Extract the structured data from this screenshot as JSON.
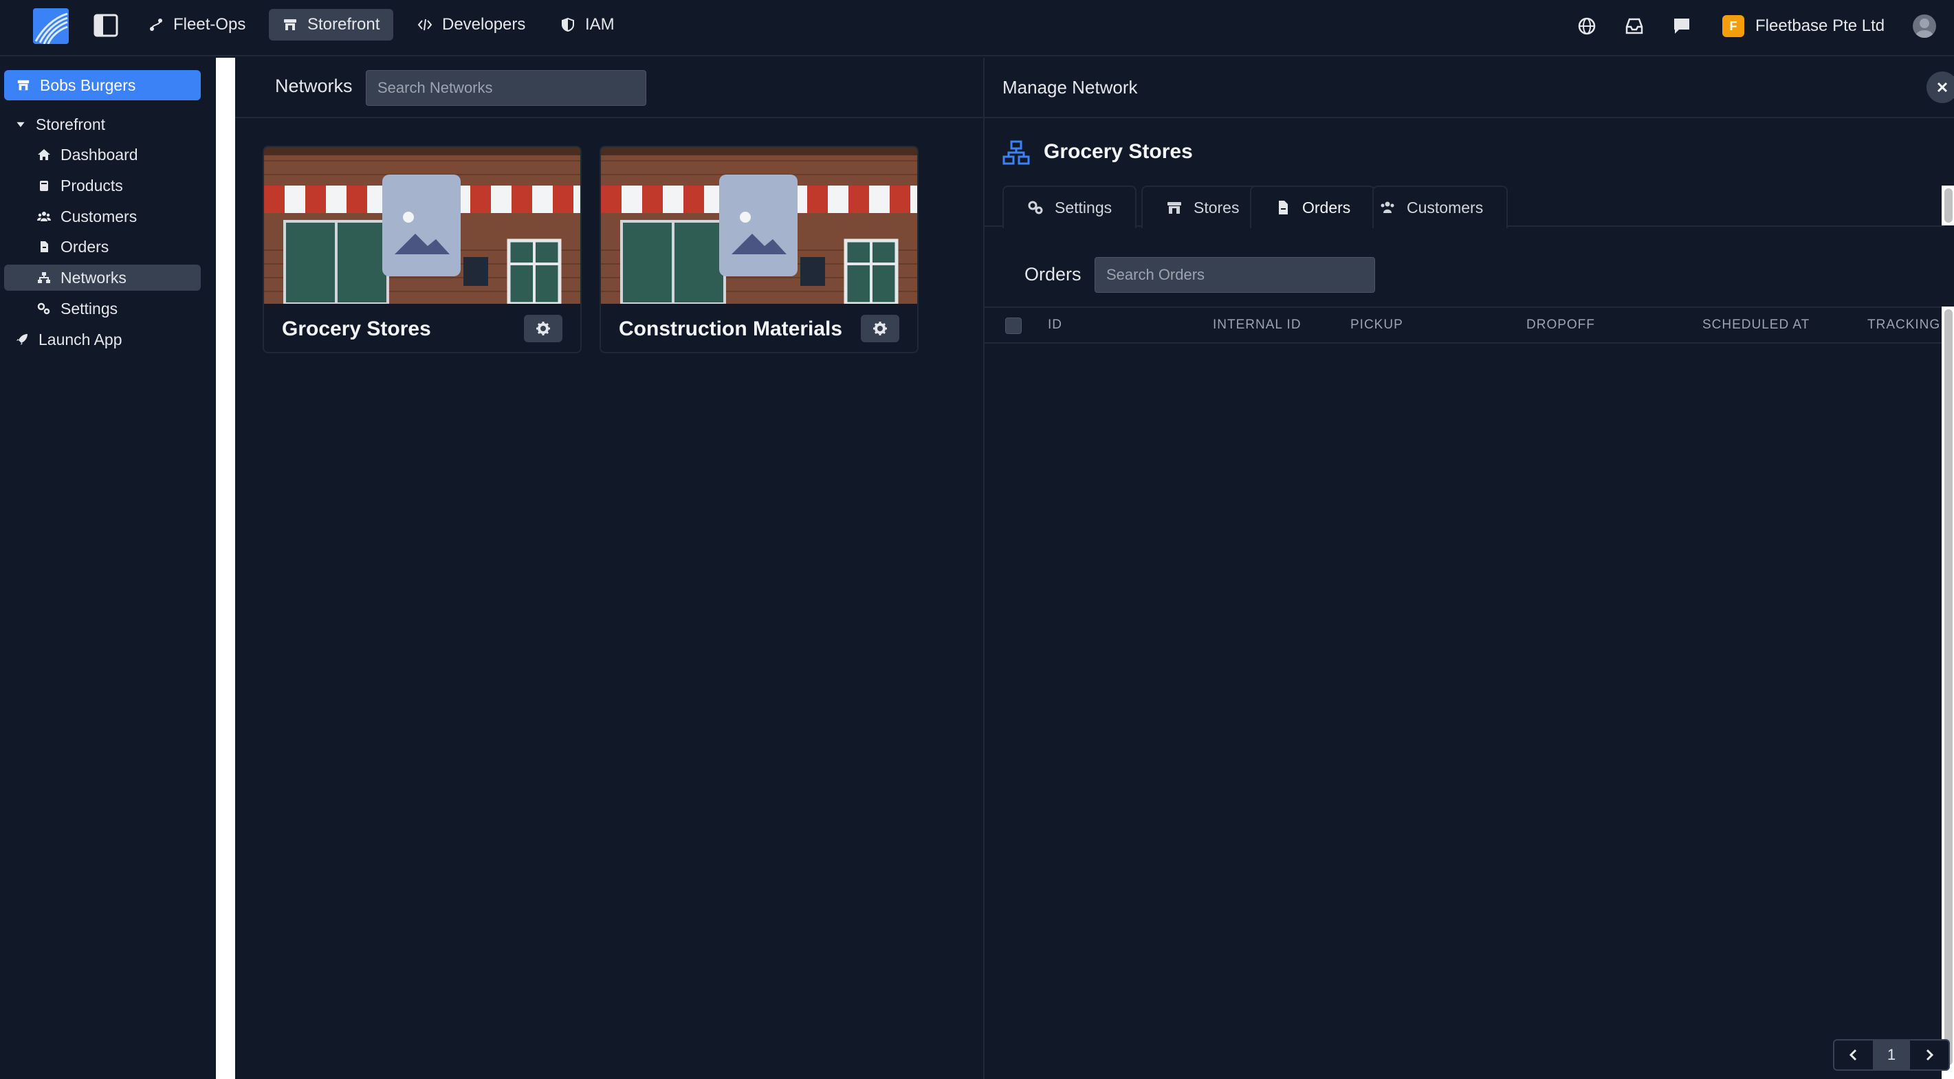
{
  "topnav": {
    "items": [
      {
        "label": "Fleet-Ops",
        "icon": "route-icon"
      },
      {
        "label": "Storefront",
        "icon": "store-icon",
        "active": true
      },
      {
        "label": "Developers",
        "icon": "code-icon"
      },
      {
        "label": "IAM",
        "icon": "shield-icon"
      }
    ],
    "org_initial": "F",
    "org_name": "Fleetbase Pte Ltd"
  },
  "sidebar": {
    "company": "Bobs Burgers",
    "section": "Storefront",
    "items": [
      {
        "label": "Dashboard",
        "icon": "home-icon"
      },
      {
        "label": "Products",
        "icon": "box-icon"
      },
      {
        "label": "Customers",
        "icon": "users-icon"
      },
      {
        "label": "Orders",
        "icon": "file-icon"
      },
      {
        "label": "Networks",
        "icon": "network-icon",
        "active": true
      },
      {
        "label": "Settings",
        "icon": "cogs-icon"
      }
    ],
    "launch": "Launch App"
  },
  "networks": {
    "title": "Networks",
    "search_placeholder": "Search Networks",
    "cards": [
      {
        "title": "Grocery Stores"
      },
      {
        "title": "Construction Materials"
      }
    ]
  },
  "manage": {
    "title": "Manage Network",
    "network_name": "Grocery Stores",
    "tabs": [
      {
        "label": "Settings",
        "icon": "cogs-icon"
      },
      {
        "label": "Stores",
        "icon": "store-icon"
      },
      {
        "label": "Orders",
        "icon": "file-icon",
        "active": true
      },
      {
        "label": "Customers",
        "icon": "users-icon"
      }
    ],
    "orders_title": "Orders",
    "orders_search_placeholder": "Search Orders",
    "columns": [
      "ID",
      "INTERNAL ID",
      "PICKUP",
      "DROPOFF",
      "SCHEDULED AT",
      "TRACKING"
    ],
    "page": "1"
  },
  "colors": {
    "background": "#111827",
    "accent": "#3b82f6",
    "panel_border": "#1f2937",
    "org_badge": "#f59e0b"
  }
}
